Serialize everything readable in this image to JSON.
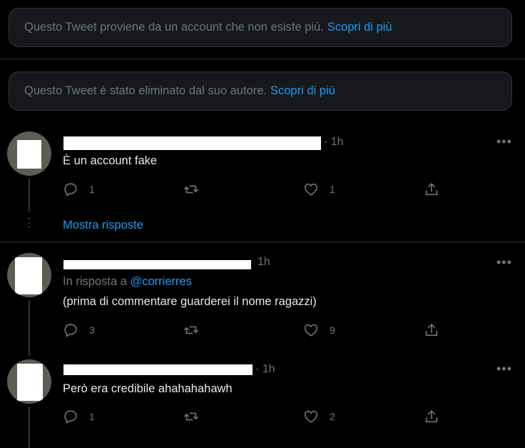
{
  "notices": [
    {
      "text": "Questo Tweet proviene da un account che non esiste più.",
      "link": "Scopri di più"
    },
    {
      "text": "Questo Tweet è stato eliminato dal suo autore.",
      "link": "Scopri di più"
    }
  ],
  "tweets": [
    {
      "time": "· 1h",
      "more": "•••",
      "text": "È un account fake",
      "reply_count": "1",
      "retweet_count": "",
      "like_count": "1"
    },
    {
      "time": "1h",
      "more": "•••",
      "reply_prefix": "In risposta a",
      "reply_mention": "@corrierres",
      "text": "(prima di commentare guarderei il nome ragazzi)",
      "reply_count": "3",
      "retweet_count": "",
      "like_count": "9"
    },
    {
      "time": "· 1h",
      "more": "•••",
      "text": "Però era credibile ahahahahawh",
      "reply_count": "1",
      "retweet_count": "",
      "like_count": "2"
    }
  ],
  "show_replies": "Mostra risposte",
  "colors": {
    "background": "#000000",
    "accent": "#1d9bf0",
    "muted": "#71767b",
    "border": "#2f3336"
  }
}
